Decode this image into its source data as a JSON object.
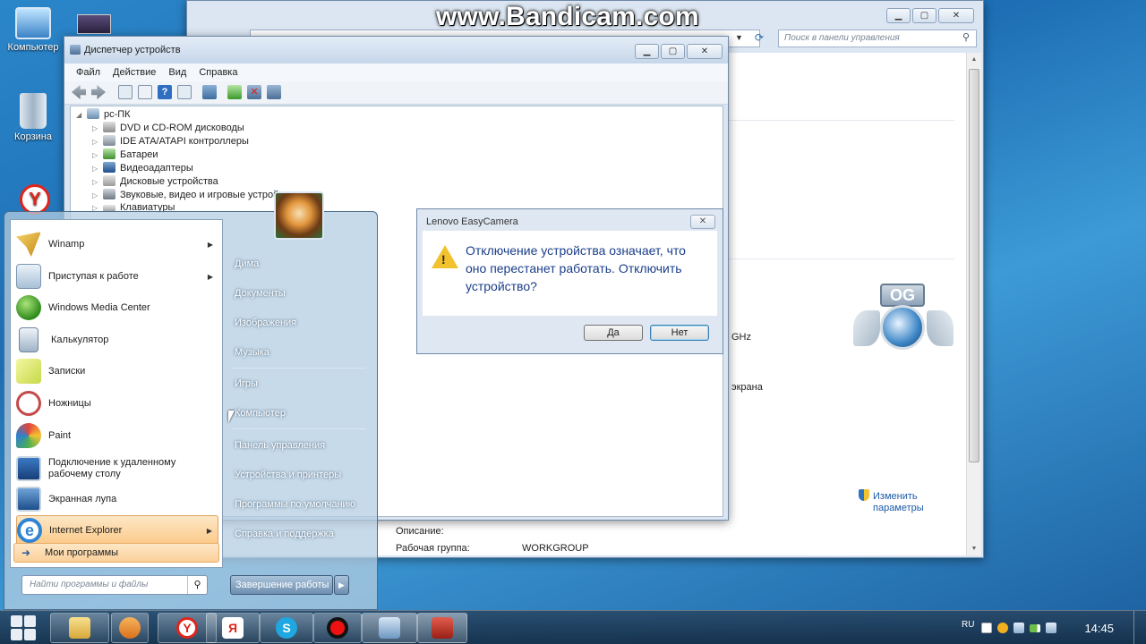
{
  "watermark": "www.Bandicam.com",
  "desktop": {
    "icons": [
      {
        "label": "Компьютер"
      },
      {
        "label": "Корзина"
      }
    ]
  },
  "control_panel": {
    "search_placeholder": "Поиск в панели управления",
    "ghz_suffix": "GHz",
    "screen_text": "экрана",
    "change_link": "Изменить параметры",
    "description_label": "Описание:",
    "workgroup_label": "Рабочая группа:",
    "workgroup_value": "WORKGROUP"
  },
  "device_manager": {
    "title": "Диспетчер устройств",
    "menu": [
      "Файл",
      "Действие",
      "Вид",
      "Справка"
    ],
    "root": "pc-ПК",
    "nodes": [
      "DVD и CD-ROM дисководы",
      "IDE ATA/ATAPI контроллеры",
      "Батареи",
      "Видеоадаптеры",
      "Дисковые устройства",
      "Звуковые, видео и игровые устройства",
      "Клавиатуры"
    ]
  },
  "dialog": {
    "title": "Lenovo EasyCamera",
    "message": "Отключение устройства означает, что оно перестанет работать. Отключить устройство?",
    "yes": "Да",
    "no": "Нет"
  },
  "start_menu": {
    "left_items": [
      {
        "label": "Winamp",
        "submenu": true
      },
      {
        "label": "Приступая к работе",
        "submenu": true
      },
      {
        "label": "Windows Media Center",
        "submenu": false
      },
      {
        "label": "Калькулятор",
        "submenu": false
      },
      {
        "label": "Записки",
        "submenu": false
      },
      {
        "label": "Ножницы",
        "submenu": false
      },
      {
        "label": "Paint",
        "submenu": false
      },
      {
        "label": "Подключение к удаленному рабочему столу",
        "submenu": false
      },
      {
        "label": "Экранная лупа",
        "submenu": false
      },
      {
        "label": "Internet Explorer",
        "submenu": true
      }
    ],
    "all_programs": "Мои программы",
    "search_placeholder": "Найти программы и файлы",
    "right_items": [
      "Дима",
      "Документы",
      "Изображения",
      "Музыка",
      "Игры",
      "Компьютер",
      "Панель управления",
      "Устройства и принтеры",
      "Программы по умолчанию",
      "Справка и поддержка"
    ],
    "shutdown": "Завершение работы"
  },
  "taskbar": {
    "lang": "RU",
    "clock": "14:45",
    "apps": [
      "explorer-icon",
      "media-player-icon",
      "yandex-browser-icon",
      "yandex-icon",
      "skype-icon",
      "record-icon",
      "control-panel-icon",
      "toolbox-icon"
    ]
  },
  "colors": {
    "accent": "#1a5aa6",
    "dialog_text": "#1a3e8a",
    "start_highlight": "#fbc987"
  }
}
